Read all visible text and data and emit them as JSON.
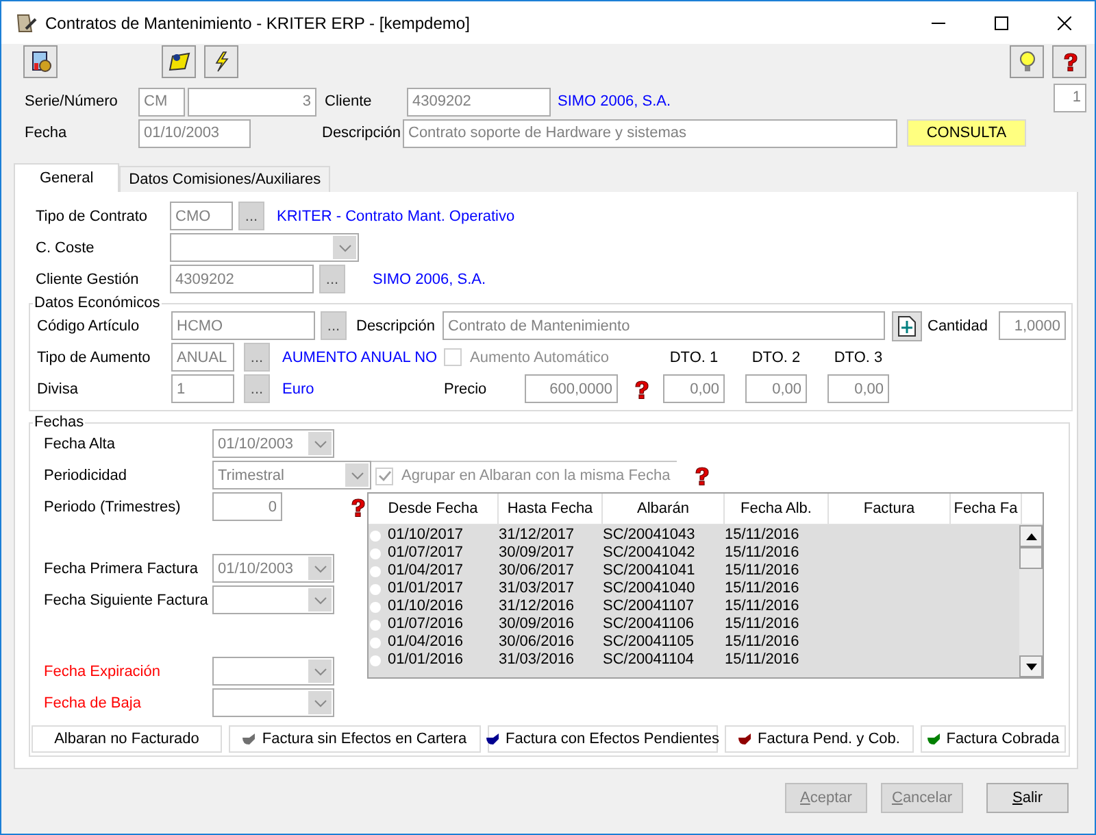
{
  "window": {
    "title": "Contratos de Mantenimiento - KRITER ERP - [kempdemo]"
  },
  "header": {
    "serie_label": "Serie/Número",
    "serie": "CM",
    "numero": "3",
    "cliente_label": "Cliente",
    "cliente": "4309202",
    "cliente_name": "SIMO 2006, S.A.",
    "page": "1",
    "fecha_label": "Fecha",
    "fecha": "01/10/2003",
    "descripcion_label": "Descripción",
    "descripcion": "Contrato soporte de Hardware y sistemas",
    "status": "CONSULTA"
  },
  "tabs": [
    {
      "label": "General",
      "selected": true
    },
    {
      "label": "Datos Comisiones/Auxiliares",
      "selected": false
    }
  ],
  "general": {
    "tipo_contrato": {
      "label": "Tipo de Contrato",
      "value": "CMO",
      "button": "...",
      "name": "KRITER - Contrato Mant. Operativo"
    },
    "c_coste": {
      "label": "C. Coste"
    },
    "cliente_gestion": {
      "label": "Cliente Gestión",
      "value": "4309202",
      "button": "...",
      "name": "SIMO 2006, S.A."
    }
  },
  "datos_economicos": {
    "title": "Datos Económicos",
    "codigo": {
      "label": "Código Artículo",
      "value": "HCMO",
      "button": "..."
    },
    "descripcion": {
      "label": "Descripción",
      "value": "Contrato de Mantenimiento"
    },
    "cantidad": {
      "label": "Cantidad",
      "value": "1,0000"
    },
    "tipo_aumento": {
      "label": "Tipo de Aumento",
      "value": "ANUAL",
      "button": "...",
      "name": "AUMENTO ANUAL NO"
    },
    "aumento_automatico": {
      "label": "Aumento Automático",
      "checked": false
    },
    "divisa": {
      "label": "Divisa",
      "value": "1",
      "button": "...",
      "name": "Euro"
    },
    "precio": {
      "label": "Precio",
      "value": "600,0000"
    },
    "descuentos": [
      {
        "label": "DTO. 1",
        "value": "0,00"
      },
      {
        "label": "DTO. 2",
        "value": "0,00"
      },
      {
        "label": "DTO. 3",
        "value": "0,00"
      }
    ]
  },
  "fechas": {
    "title": "Fechas",
    "rows": [
      {
        "label": "Fecha Alta",
        "kind": "date",
        "value": "01/10/2003",
        "highlight": false
      },
      {
        "label": "Periodicidad",
        "kind": "select",
        "value": "Trimestral",
        "highlight": false
      },
      {
        "label": "Periodo (Trimestres)",
        "kind": "number",
        "value": "0",
        "highlight": false
      },
      {
        "label": "Fecha Primera Factura",
        "kind": "date",
        "value": "01/10/2003",
        "highlight": false
      },
      {
        "label": "Fecha Siguiente Factura",
        "kind": "date",
        "highlight": false
      },
      {
        "label": "Fecha Expiración",
        "kind": "date",
        "highlight": true
      },
      {
        "label": "Fecha de Baja",
        "kind": "date",
        "highlight": true
      }
    ],
    "agrupar": {
      "label": "Agrupar en Albaran con la misma Fecha",
      "checked": true
    }
  },
  "table": {
    "columns": [
      "Desde Fecha",
      "Hasta Fecha",
      "Albarán",
      "Fecha Alb.",
      "Factura",
      "Fecha Fa"
    ],
    "rows": [
      [
        "01/10/2017",
        "31/12/2017",
        "SC/20041043",
        "15/11/2016"
      ],
      [
        "01/07/2017",
        "30/09/2017",
        "SC/20041042",
        "15/11/2016"
      ],
      [
        "01/04/2017",
        "30/06/2017",
        "SC/20041041",
        "15/11/2016"
      ],
      [
        "01/01/2017",
        "31/03/2017",
        "SC/20041040",
        "15/11/2016"
      ],
      [
        "01/10/2016",
        "31/12/2016",
        "SC/20041107",
        "15/11/2016"
      ],
      [
        "01/07/2016",
        "30/09/2016",
        "SC/20041106",
        "15/11/2016"
      ],
      [
        "01/04/2016",
        "30/06/2016",
        "SC/20041105",
        "15/11/2016"
      ],
      [
        "01/01/2016",
        "31/03/2016",
        "SC/20041104",
        "15/11/2016"
      ]
    ]
  },
  "legend": [
    {
      "label": "Albaran no Facturado"
    },
    {
      "label": "Factura sin Efectos en Cartera",
      "color": "#707070"
    },
    {
      "label": "Factura con Efectos Pendientes",
      "color": "#000090"
    },
    {
      "label": "Factura Pend. y Cob.",
      "color": "#900000"
    },
    {
      "label": "Factura Cobrada",
      "color": "#008000"
    }
  ],
  "buttons": [
    {
      "label": "Aceptar",
      "disabled": true
    },
    {
      "label": "Cancelar",
      "disabled": true
    },
    {
      "label": "Salir",
      "disabled": false
    }
  ]
}
